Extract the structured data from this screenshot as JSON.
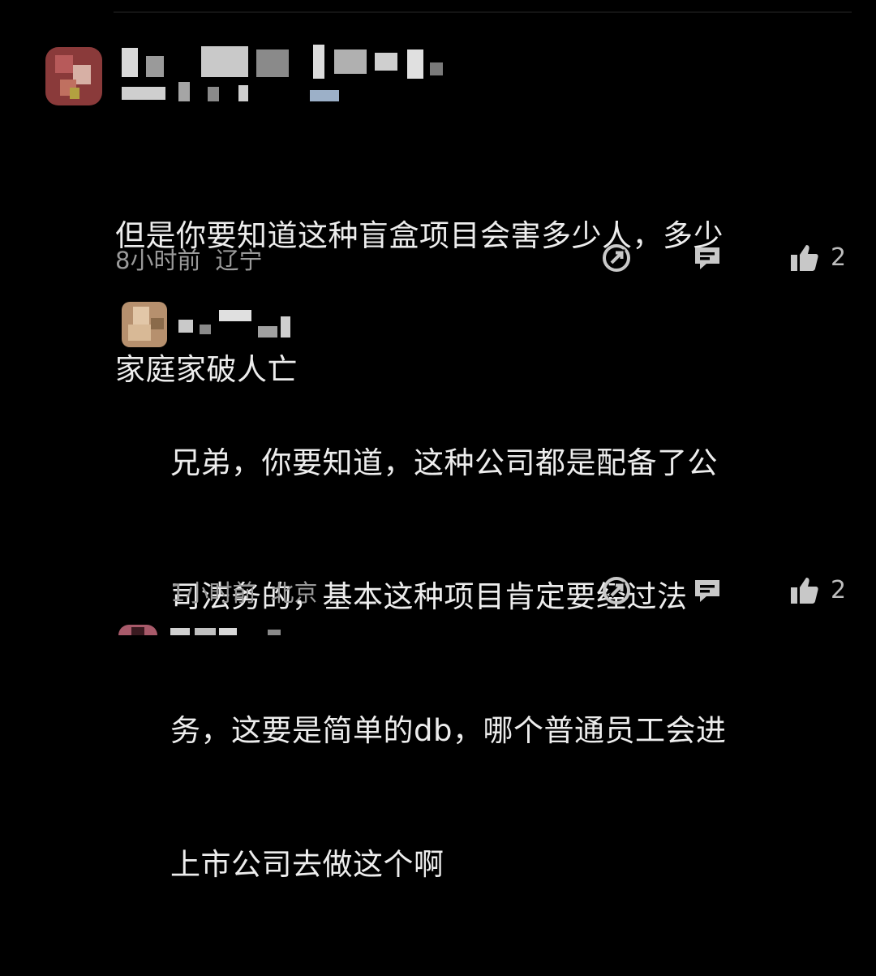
{
  "comments": [
    {
      "text_lines": [
        "但是你要知道这种盲盒项目会害多少人，多少",
        "家庭家破人亡"
      ],
      "time": "8小时前",
      "location": "辽宁",
      "likes": "2",
      "icons": [
        "share-icon",
        "reply-icon",
        "thumbs-up-icon"
      ]
    },
    {
      "text_lines": [
        "兄弟，你要知道，这种公司都是配备了公",
        "司法务的，基本这种项目肯定要经过法",
        "务，这要是简单的db，哪个普通员工会进",
        "上市公司去做这个啊"
      ],
      "time": "1小时前",
      "location": "北京",
      "likes": "2",
      "icons": [
        "share-icon",
        "reply-icon",
        "thumbs-up-icon"
      ]
    }
  ],
  "colors": {
    "background": "#000000",
    "text": "#ededed",
    "meta": "#9a9a9a",
    "icon": "#c8c8c8"
  }
}
